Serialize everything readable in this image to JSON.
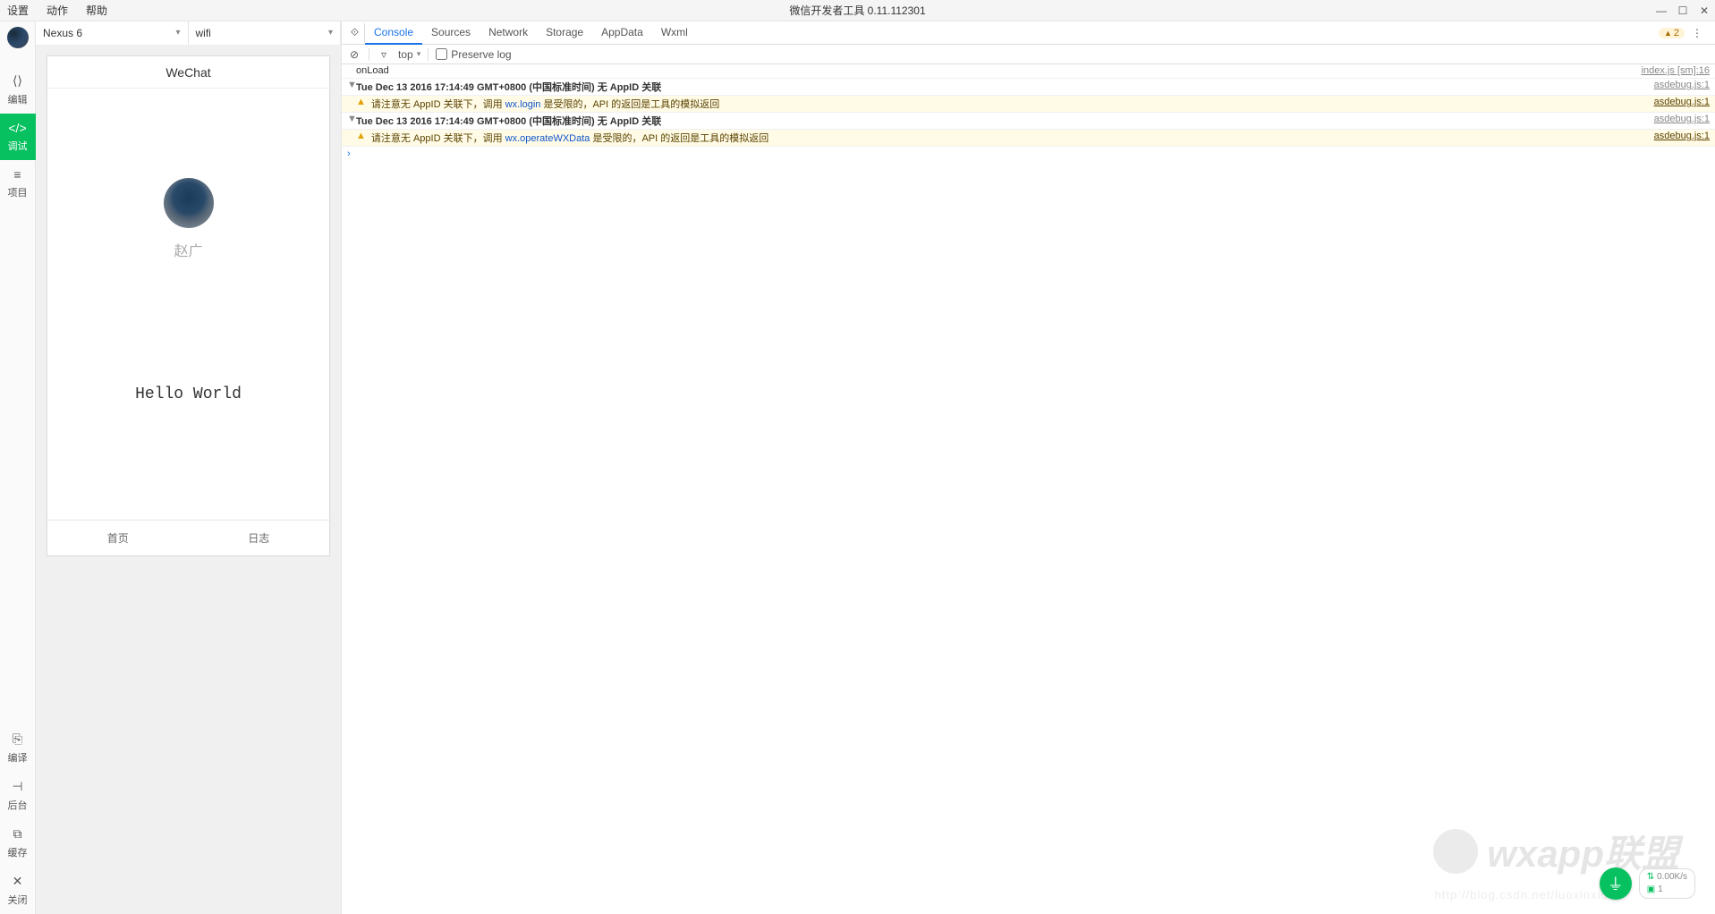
{
  "window": {
    "title": "微信开发者工具 0.11.112301",
    "menu": {
      "settings": "设置",
      "actions": "动作",
      "help": "帮助"
    }
  },
  "sidebar": {
    "items": [
      {
        "icon": "⟨⟩",
        "label": "编辑"
      },
      {
        "icon": "</>",
        "label": "调试"
      },
      {
        "icon": "≡",
        "label": "项目"
      }
    ],
    "bottom": [
      {
        "icon": "⎘",
        "label": "编译"
      },
      {
        "icon": "⊣",
        "label": "后台"
      },
      {
        "icon": "⧉",
        "label": "缓存"
      },
      {
        "icon": "✕",
        "label": "关闭"
      }
    ]
  },
  "simulator": {
    "device": "Nexus 6",
    "network": "wifi",
    "app_title": "WeChat",
    "username": "赵广",
    "hello": "Hello World",
    "tabs": {
      "home": "首页",
      "log": "日志"
    }
  },
  "devtools": {
    "tabs": [
      "Console",
      "Sources",
      "Network",
      "Storage",
      "AppData",
      "Wxml"
    ],
    "active_tab": "Console",
    "warn_count": "2",
    "toolbar": {
      "context": "top",
      "preserve_label": "Preserve log",
      "preserve_checked": false
    },
    "console": [
      {
        "type": "log",
        "arrow": "",
        "text": "onLoad",
        "src": "index.js [sm]:16"
      },
      {
        "type": "bold",
        "arrow": "▼",
        "text": "Tue Dec 13 2016 17:14:49 GMT+0800 (中国标准时间) 无 AppID 关联",
        "src": "asdebug.js:1"
      },
      {
        "type": "warn",
        "arrow": "",
        "text_pre": "请注意无 AppID 关联下，调用 ",
        "code": "wx.login",
        "text_post": " 是受限的，API 的返回是工具的模拟返回",
        "src": "asdebug.js:1"
      },
      {
        "type": "bold",
        "arrow": "▼",
        "text": "Tue Dec 13 2016 17:14:49 GMT+0800 (中国标准时间) 无 AppID 关联",
        "src": "asdebug.js:1"
      },
      {
        "type": "warn",
        "arrow": "",
        "text_pre": "请注意无 AppID 关联下，调用 ",
        "code": "wx.operateWXData",
        "text_post": " 是受限的，API 的返回是工具的模拟返回",
        "src": "asdebug.js:1"
      }
    ]
  },
  "status": {
    "speed": "0.00K/s",
    "count": "1"
  },
  "watermark": {
    "text": "wxapp联盟",
    "url": "http://blog.csdn.net/luoxinxic"
  }
}
